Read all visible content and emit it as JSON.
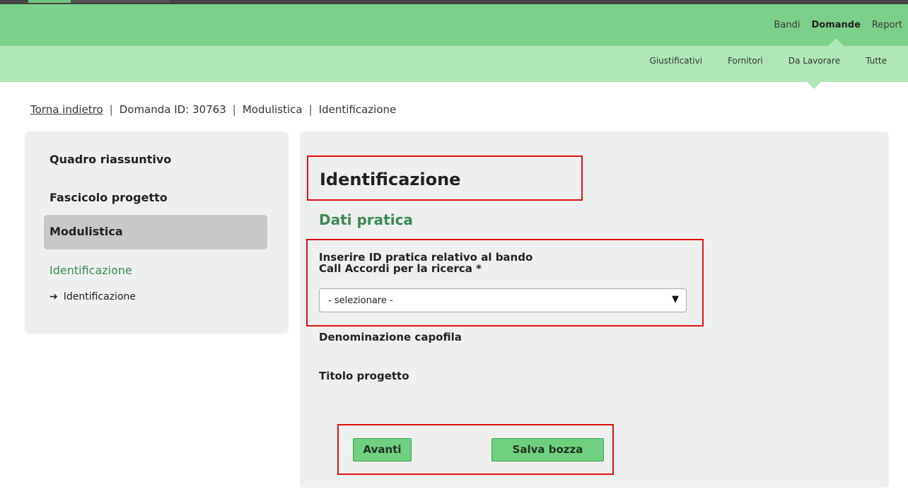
{
  "topnav": {
    "items": [
      "Bandi",
      "Domande",
      "Report"
    ],
    "active": "Domande"
  },
  "subnav": {
    "items": [
      "Giustificativi",
      "Fornitori",
      "Da Lavorare",
      "Tutte"
    ],
    "active": "Da Lavorare"
  },
  "breadcrumb": {
    "back": "Torna indietro",
    "items": [
      "Domanda ID: 30763",
      "Modulistica",
      "Identificazione"
    ],
    "separator": "|"
  },
  "sidebar": {
    "items": [
      "Quadro riassuntivo",
      "Fascicolo progetto",
      "Modulistica"
    ],
    "active": "Modulistica",
    "section": "Identificazione",
    "subitem": "Identificazione",
    "subitem_arrow": "➔"
  },
  "main": {
    "title": "Identificazione",
    "section_title": "Dati pratica",
    "field_label_line1": "Inserire ID pratica relativo al bando",
    "field_label_line2": "Call Accordi per la ricerca *",
    "select_value": "- selezionare -",
    "select_caret": "▼",
    "label_denominazione": "Denominazione capofila",
    "label_titolo": "Titolo progetto"
  },
  "buttons": {
    "avanti": "Avanti",
    "salva_bozza": "Salva bozza"
  },
  "colors": {
    "topbar": "#7bd18b",
    "subbar": "#b0e7b8",
    "accent_green": "#3b8a53",
    "button": "#6fd17f",
    "highlight_red": "#e01010"
  }
}
